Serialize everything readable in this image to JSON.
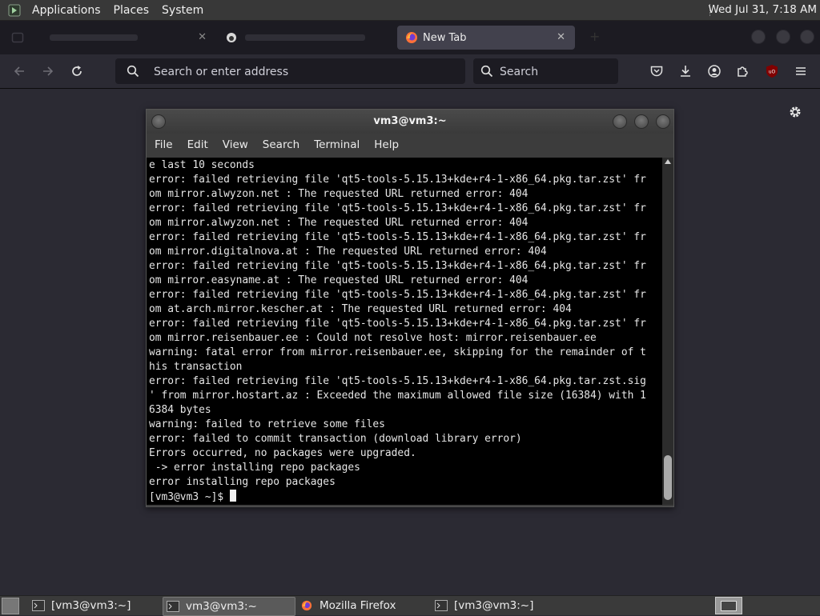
{
  "top_panel": {
    "menus": [
      "Applications",
      "Places",
      "System"
    ],
    "clock": "Wed Jul 31, 7:18 AM"
  },
  "browser": {
    "tabs": [
      {
        "label": "",
        "active": false
      },
      {
        "label": "",
        "active": false
      },
      {
        "label": "New Tab",
        "active": true
      }
    ],
    "url_placeholder": "Search or enter address",
    "search_placeholder": "Search"
  },
  "terminal": {
    "title": "vm3@vm3:~",
    "menus": [
      "File",
      "Edit",
      "View",
      "Search",
      "Terminal",
      "Help"
    ],
    "lines": [
      "e last 10 seconds",
      "error: failed retrieving file 'qt5-tools-5.15.13+kde+r4-1-x86_64.pkg.tar.zst' fr",
      "om mirror.alwyzon.net : The requested URL returned error: 404",
      "error: failed retrieving file 'qt5-tools-5.15.13+kde+r4-1-x86_64.pkg.tar.zst' fr",
      "om mirror.alwyzon.net : The requested URL returned error: 404",
      "error: failed retrieving file 'qt5-tools-5.15.13+kde+r4-1-x86_64.pkg.tar.zst' fr",
      "om mirror.digitalnova.at : The requested URL returned error: 404",
      "error: failed retrieving file 'qt5-tools-5.15.13+kde+r4-1-x86_64.pkg.tar.zst' fr",
      "om mirror.easyname.at : The requested URL returned error: 404",
      "error: failed retrieving file 'qt5-tools-5.15.13+kde+r4-1-x86_64.pkg.tar.zst' fr",
      "om at.arch.mirror.kescher.at : The requested URL returned error: 404",
      "error: failed retrieving file 'qt5-tools-5.15.13+kde+r4-1-x86_64.pkg.tar.zst' fr",
      "om mirror.reisenbauer.ee : Could not resolve host: mirror.reisenbauer.ee",
      "warning: fatal error from mirror.reisenbauer.ee, skipping for the remainder of t",
      "his transaction",
      "error: failed retrieving file 'qt5-tools-5.15.13+kde+r4-1-x86_64.pkg.tar.zst.sig",
      "' from mirror.hostart.az : Exceeded the maximum allowed file size (16384) with 1",
      "6384 bytes",
      "warning: failed to retrieve some files",
      "error: failed to commit transaction (download library error)",
      "Errors occurred, no packages were upgraded.",
      " -> error installing repo packages",
      "error installing repo packages"
    ],
    "prompt": "[vm3@vm3 ~]$ "
  },
  "taskbar": {
    "items": [
      {
        "label": "[vm3@vm3:~]",
        "icon": "terminal-icon",
        "active": false
      },
      {
        "label": "vm3@vm3:~",
        "icon": "terminal-icon",
        "active": true
      },
      {
        "label": "Mozilla Firefox",
        "icon": "firefox-icon",
        "active": false
      },
      {
        "label": "[vm3@vm3:~]",
        "icon": "terminal-icon",
        "active": false
      }
    ]
  }
}
